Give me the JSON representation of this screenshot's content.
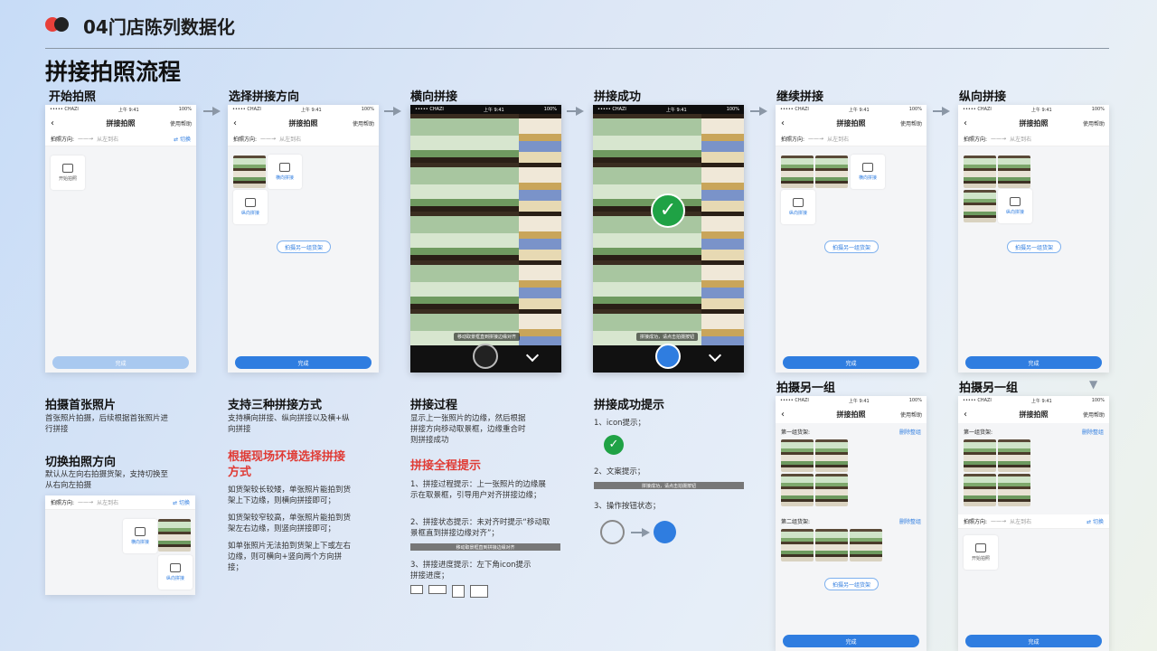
{
  "header": {
    "title": "04门店陈列数据化",
    "main_title": "拼接拍照流程"
  },
  "steps": {
    "s1": "开始拍照",
    "s2": "选择拼接方向",
    "s3": "横向拼接",
    "s4": "拼接成功",
    "s5": "继续拼接",
    "s6": "纵向拼接",
    "s7": "拍摄另一组",
    "s8": "拍摄另一组"
  },
  "phone": {
    "carrier": "••••• CHAZI",
    "time": "上午 9:41",
    "battery": "100%",
    "title": "拼接拍照",
    "help": "使用帮助",
    "back": "‹",
    "dir_label": "拍照方向:",
    "dir_arrow": "——→",
    "dir_value": "从左到右",
    "switch": "⇄ 切换",
    "start": "开始拍照",
    "horizontal": "横向拼接",
    "vertical": "纵向拼接",
    "another": "拍摄另一组货架",
    "done": "完成",
    "group1": "第一组货架:",
    "group2": "第二组货架:",
    "delete": "删除整组"
  },
  "camera": {
    "tip_align": "移动取景框直到拼接边缘对齐",
    "tip_success": "拼接成功，请点击拍摄按钮"
  },
  "sections": {
    "first": {
      "title": "拍摄首张照片",
      "text": "首张照片拍摄，后续根据首张照片进行拼接"
    },
    "switch_dir": {
      "title": "切换拍照方向",
      "text": "默认从左向右拍摄货架，支持切换至从右向左拍摄"
    },
    "three": {
      "title": "支持三种拼接方式",
      "text": "支持横向拼接、纵向拼接以及横+纵向拼接"
    },
    "choose": {
      "title": "根据现场环境选择拼接方式",
      "p1": "如货架较长较矮，单张照片能拍到货架上下边缘，则横向拼接即可；",
      "p2": "如货架较窄较高，单张照片能拍到货架左右边缘，则竖向拼接即可；",
      "p3": "如单张照片无法拍到货架上下或左右边缘，则可横向+竖向两个方向拼接；"
    },
    "process": {
      "title": "拼接过程",
      "text": "显示上一张照片的边缘，然后根据拼接方向移动取景框，边缘重合时则拼接成功"
    },
    "hints": {
      "title": "拼接全程提示",
      "h1": "1、拼接过程提示：上一张照片的边缘展示在取景框，引导用户对齐拼接边缘；",
      "h2": "2、拼接状态提示：未对齐时提示“移动取景框直到拼接边缘对齐”；",
      "h3": "3、拼接进度提示：左下角icon提示拼接进度；"
    },
    "success": {
      "title": "拼接成功提示",
      "s1": "1、icon提示；",
      "s2": "2、文案提示；",
      "s3": "3、操作按钮状态；"
    }
  },
  "colors": {
    "accent": "#2f7de0",
    "red": "#e03b35",
    "success": "#1fa245"
  }
}
